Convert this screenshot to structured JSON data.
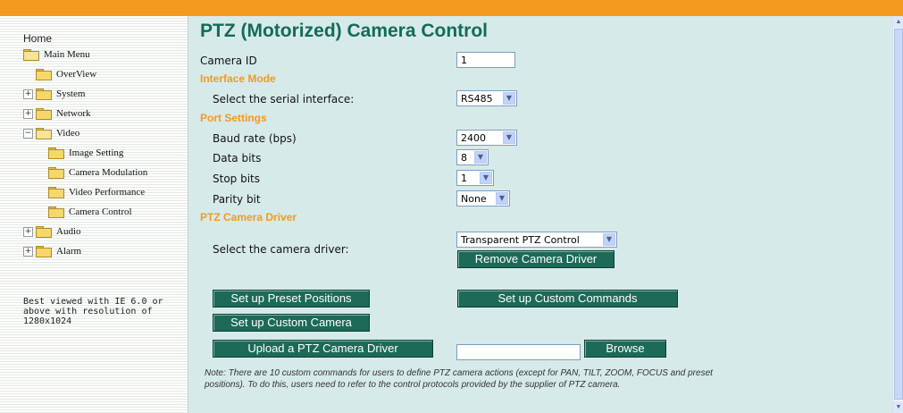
{
  "sidebar": {
    "home": "Home",
    "items": [
      {
        "label": "Main Menu",
        "expander": ""
      },
      {
        "label": "OverView",
        "expander": ""
      },
      {
        "label": "System",
        "expander": "+"
      },
      {
        "label": "Network",
        "expander": "+"
      },
      {
        "label": "Video",
        "expander": "−"
      },
      {
        "label": "Image Setting",
        "expander": ""
      },
      {
        "label": "Camera Modulation",
        "expander": ""
      },
      {
        "label": "Video Performance",
        "expander": ""
      },
      {
        "label": "Camera Control",
        "expander": ""
      },
      {
        "label": "Audio",
        "expander": "+"
      },
      {
        "label": "Alarm",
        "expander": "+"
      }
    ],
    "note": "Best viewed with IE 6.0 or above with resolution of 1280x1024"
  },
  "main": {
    "title": "PTZ (Motorized) Camera Control",
    "camera_id_label": "Camera ID",
    "camera_id_value": "1",
    "interface_section": "Interface Mode",
    "serial_label": "Select the serial interface:",
    "serial_value": "RS485",
    "port_section": "Port Settings",
    "baud_label": "Baud rate (bps)",
    "baud_value": "2400",
    "data_bits_label": "Data bits",
    "data_bits_value": "8",
    "stop_bits_label": "Stop bits",
    "stop_bits_value": "1",
    "parity_label": "Parity bit",
    "parity_value": "None",
    "driver_section": "PTZ Camera Driver",
    "driver_label": "Select the camera driver:",
    "driver_value": "Transparent PTZ Control",
    "remove_driver_button": "Remove Camera Driver",
    "preset_button": "Set up Preset Positions",
    "custom_commands_button": "Set up Custom Commands",
    "custom_camera_button": "Set up Custom Camera",
    "upload_button": "Upload a PTZ Camera Driver",
    "upload_file_value": "",
    "browse_button": "Browse",
    "note": "Note: There are 10 custom commands for users to define PTZ camera actions (except for PAN, TILT, ZOOM, FOCUS and preset positions). To do this, users need to refer to the control protocols provided by the supplier of PTZ camera."
  },
  "colors": {
    "accent_orange": "#f39a1f",
    "title_green": "#126c57",
    "button_green": "#1c6a57",
    "panel_bg": "#d7eaea"
  }
}
